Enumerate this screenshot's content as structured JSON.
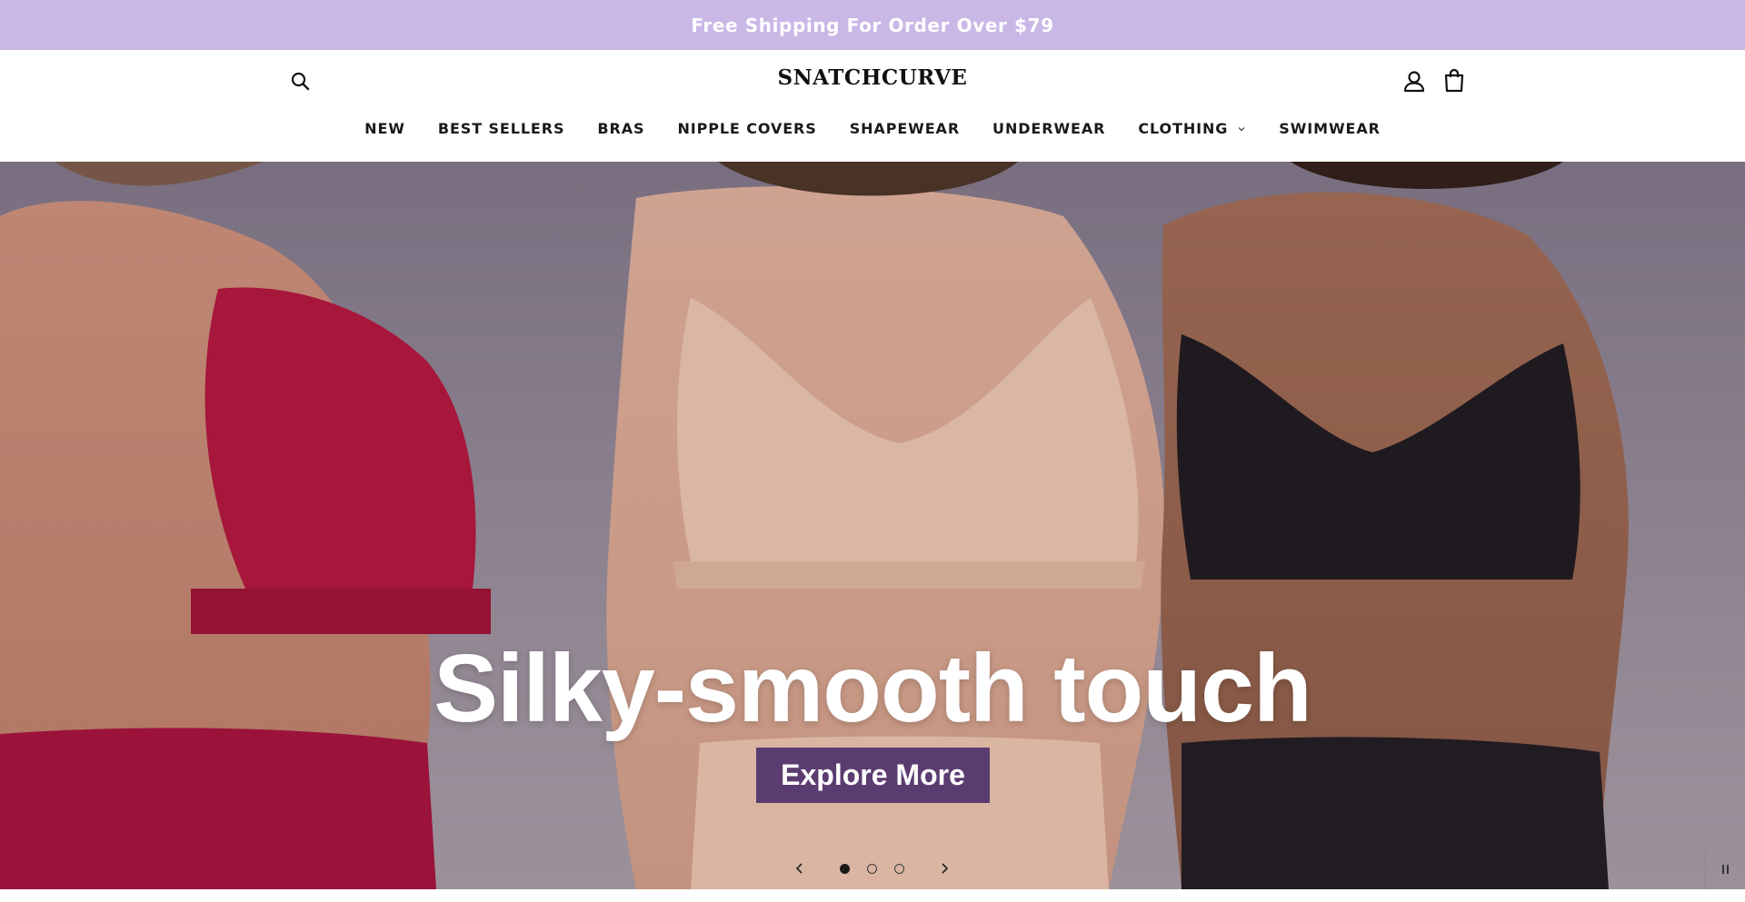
{
  "announcement": {
    "text": "Free Shipping For Order Over $79"
  },
  "header": {
    "logo": "SNATCHCURVE",
    "icons": {
      "search": "search-icon",
      "account": "account-icon",
      "cart": "cart-icon"
    }
  },
  "nav": {
    "items": [
      {
        "label": "NEW"
      },
      {
        "label": "BEST SELLERS"
      },
      {
        "label": "BRAS"
      },
      {
        "label": "NIPPLE COVERS"
      },
      {
        "label": "SHAPEWEAR"
      },
      {
        "label": "UNDERWEAR"
      },
      {
        "label": "CLOTHING",
        "has_dropdown": true
      },
      {
        "label": "SWIMWEAR"
      }
    ]
  },
  "hero": {
    "title": "Silky-smooth touch",
    "cta": "Explore More",
    "slides_count": 3,
    "active_slide": 1,
    "controls": {
      "prev": "chevron-left-icon",
      "next": "chevron-right-icon",
      "pause": "pause-icon"
    }
  },
  "colors": {
    "announcement_bg": "#c9b8e6",
    "cta_bg": "#5b3c70",
    "text": "#121212"
  }
}
